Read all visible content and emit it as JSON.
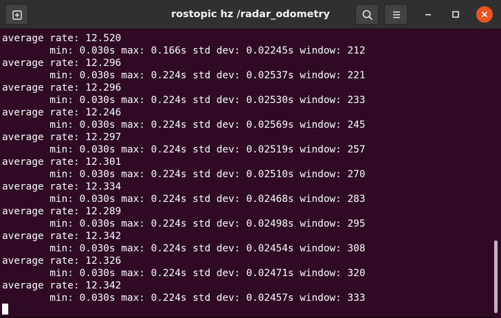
{
  "window": {
    "title": "rostopic hz /radar_odometry"
  },
  "icons": {
    "new_tab": "new-tab-icon",
    "search": "search-icon",
    "menu": "hamburger-menu-icon",
    "minimize": "minimize-icon",
    "maximize": "maximize-icon",
    "close": "close-icon"
  },
  "colors": {
    "terminal_background": "#300a24",
    "terminal_text": "#ffffff",
    "titlebar": "#303030",
    "close_button": "#e95420"
  },
  "terminal": {
    "lines": [
      "average rate: 12.520",
      "        min: 0.030s max: 0.166s std dev: 0.02245s window: 212",
      "average rate: 12.296",
      "        min: 0.030s max: 0.224s std dev: 0.02537s window: 221",
      "average rate: 12.296",
      "        min: 0.030s max: 0.224s std dev: 0.02530s window: 233",
      "average rate: 12.246",
      "        min: 0.030s max: 0.224s std dev: 0.02569s window: 245",
      "average rate: 12.297",
      "        min: 0.030s max: 0.224s std dev: 0.02519s window: 257",
      "average rate: 12.301",
      "        min: 0.030s max: 0.224s std dev: 0.02510s window: 270",
      "average rate: 12.334",
      "        min: 0.030s max: 0.224s std dev: 0.02468s window: 283",
      "average rate: 12.289",
      "        min: 0.030s max: 0.224s std dev: 0.02498s window: 295",
      "average rate: 12.342",
      "        min: 0.030s max: 0.224s std dev: 0.02454s window: 308",
      "average rate: 12.326",
      "        min: 0.030s max: 0.224s std dev: 0.02471s window: 320",
      "average rate: 12.342",
      "        min: 0.030s max: 0.224s std dev: 0.02457s window: 333"
    ]
  }
}
